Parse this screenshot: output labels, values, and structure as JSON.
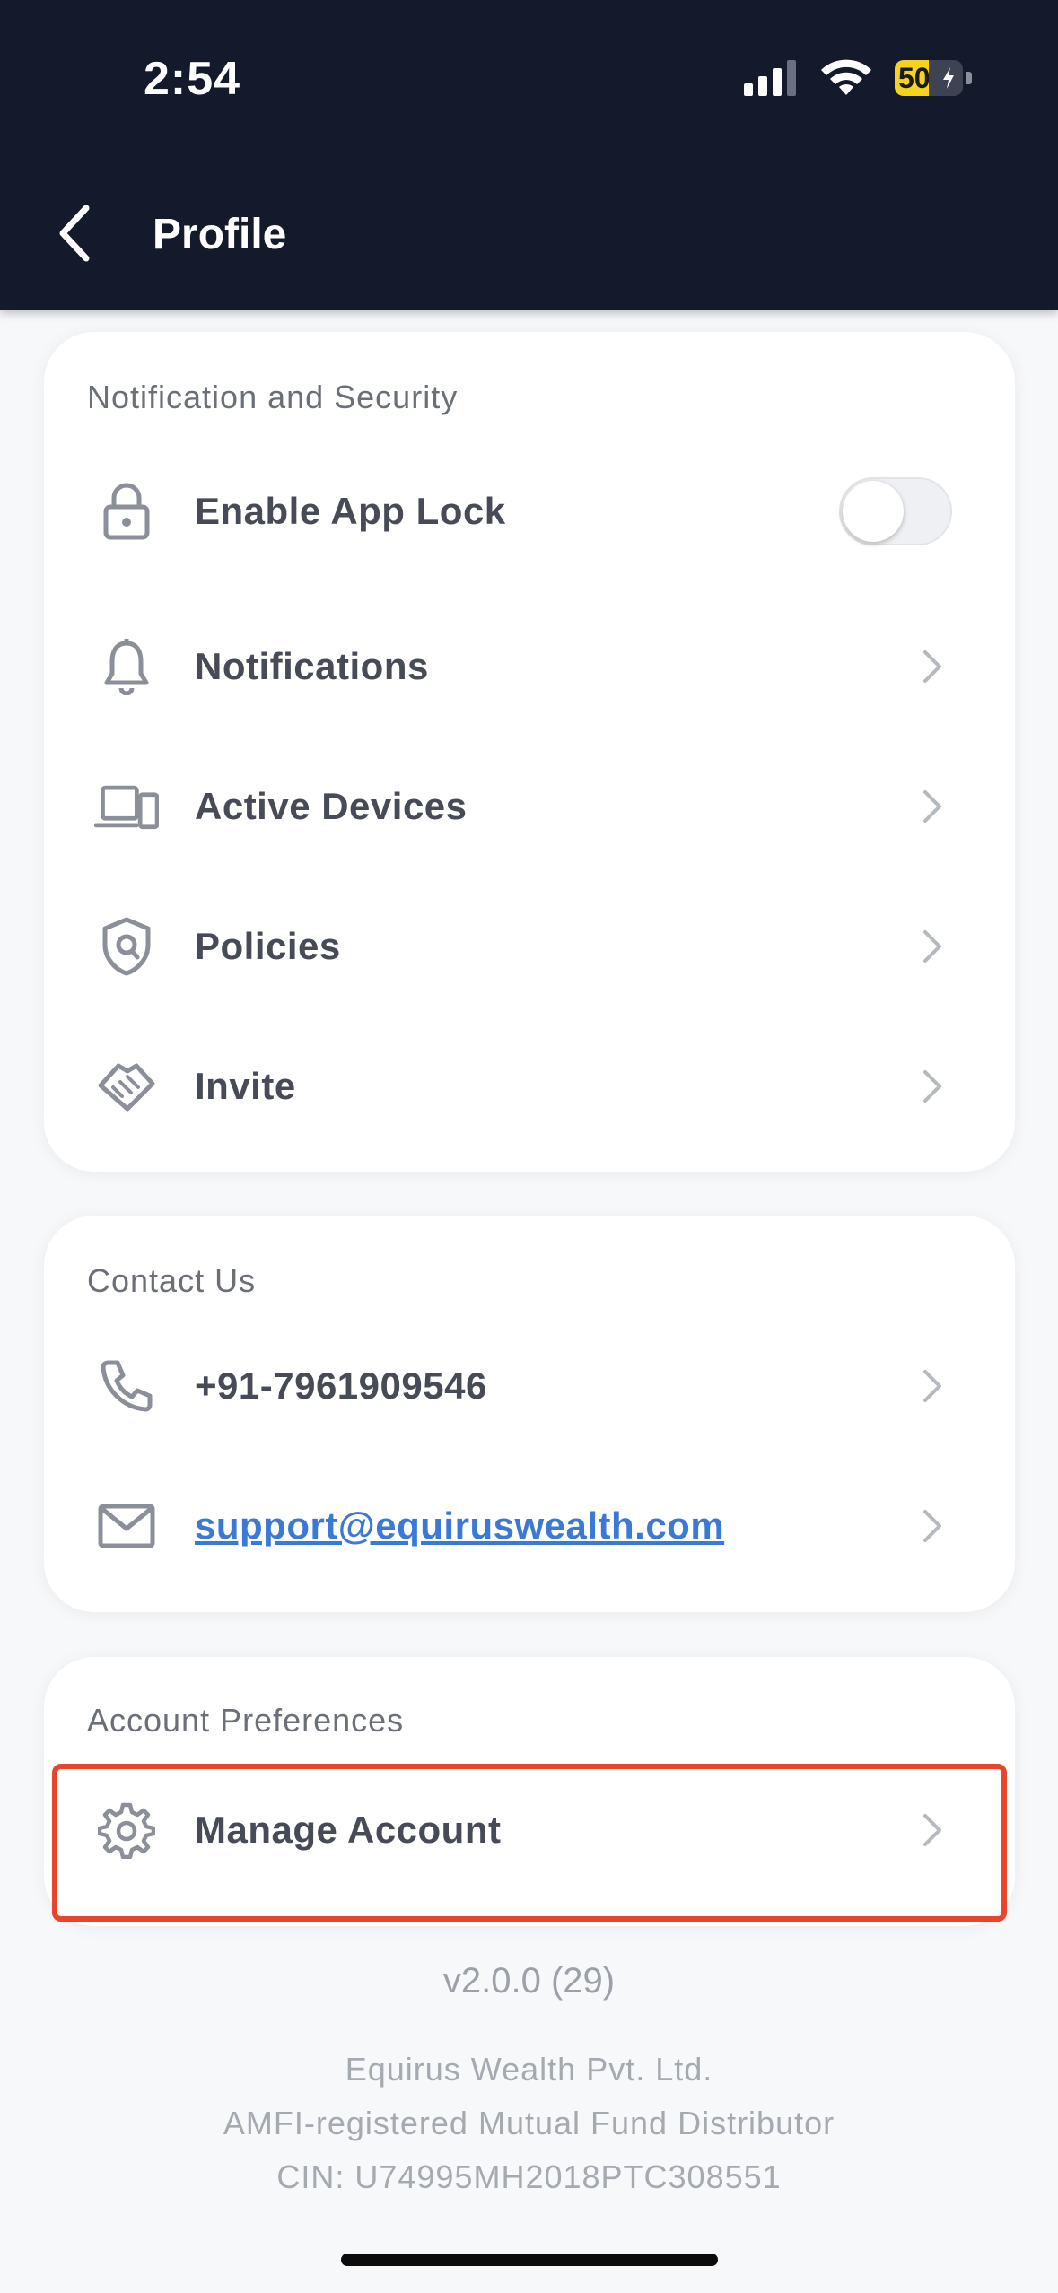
{
  "status_bar": {
    "time": "2:54",
    "battery_text": "50",
    "battery_level": 0.5,
    "icons": [
      "signal-icon",
      "wifi-icon",
      "battery-icon"
    ]
  },
  "header": {
    "title": "Profile",
    "background": "#121a2b"
  },
  "notification_security": {
    "title": "Notification and Security",
    "items": [
      {
        "label": "Enable App Lock",
        "icon": "lock-icon",
        "control": "toggle",
        "toggle_on": false
      },
      {
        "label": "Notifications",
        "icon": "bell-icon",
        "control": "chevron"
      },
      {
        "label": "Active Devices",
        "icon": "devices-icon",
        "control": "chevron"
      },
      {
        "label": "Policies",
        "icon": "shield-icon",
        "control": "chevron"
      },
      {
        "label": "Invite",
        "icon": "handshake-icon",
        "control": "chevron"
      }
    ]
  },
  "contact_us": {
    "title": "Contact Us",
    "phone": "+91-7961909546",
    "email": "support@equiruswealth.com"
  },
  "account_preferences": {
    "title": "Account Preferences",
    "manage_account": "Manage Account",
    "highlight_color": "#e8452d"
  },
  "footer": {
    "version": "v2.0.0 (29)",
    "company": "Equirus Wealth Pvt. Ltd.",
    "registration": "AMFI-registered Mutual Fund Distributor",
    "cin": "CIN: U74995MH2018PTC308551"
  },
  "colors": {
    "link": "#3b79d6",
    "icon": "#8a8f99",
    "chevron": "#b5b9c0"
  }
}
